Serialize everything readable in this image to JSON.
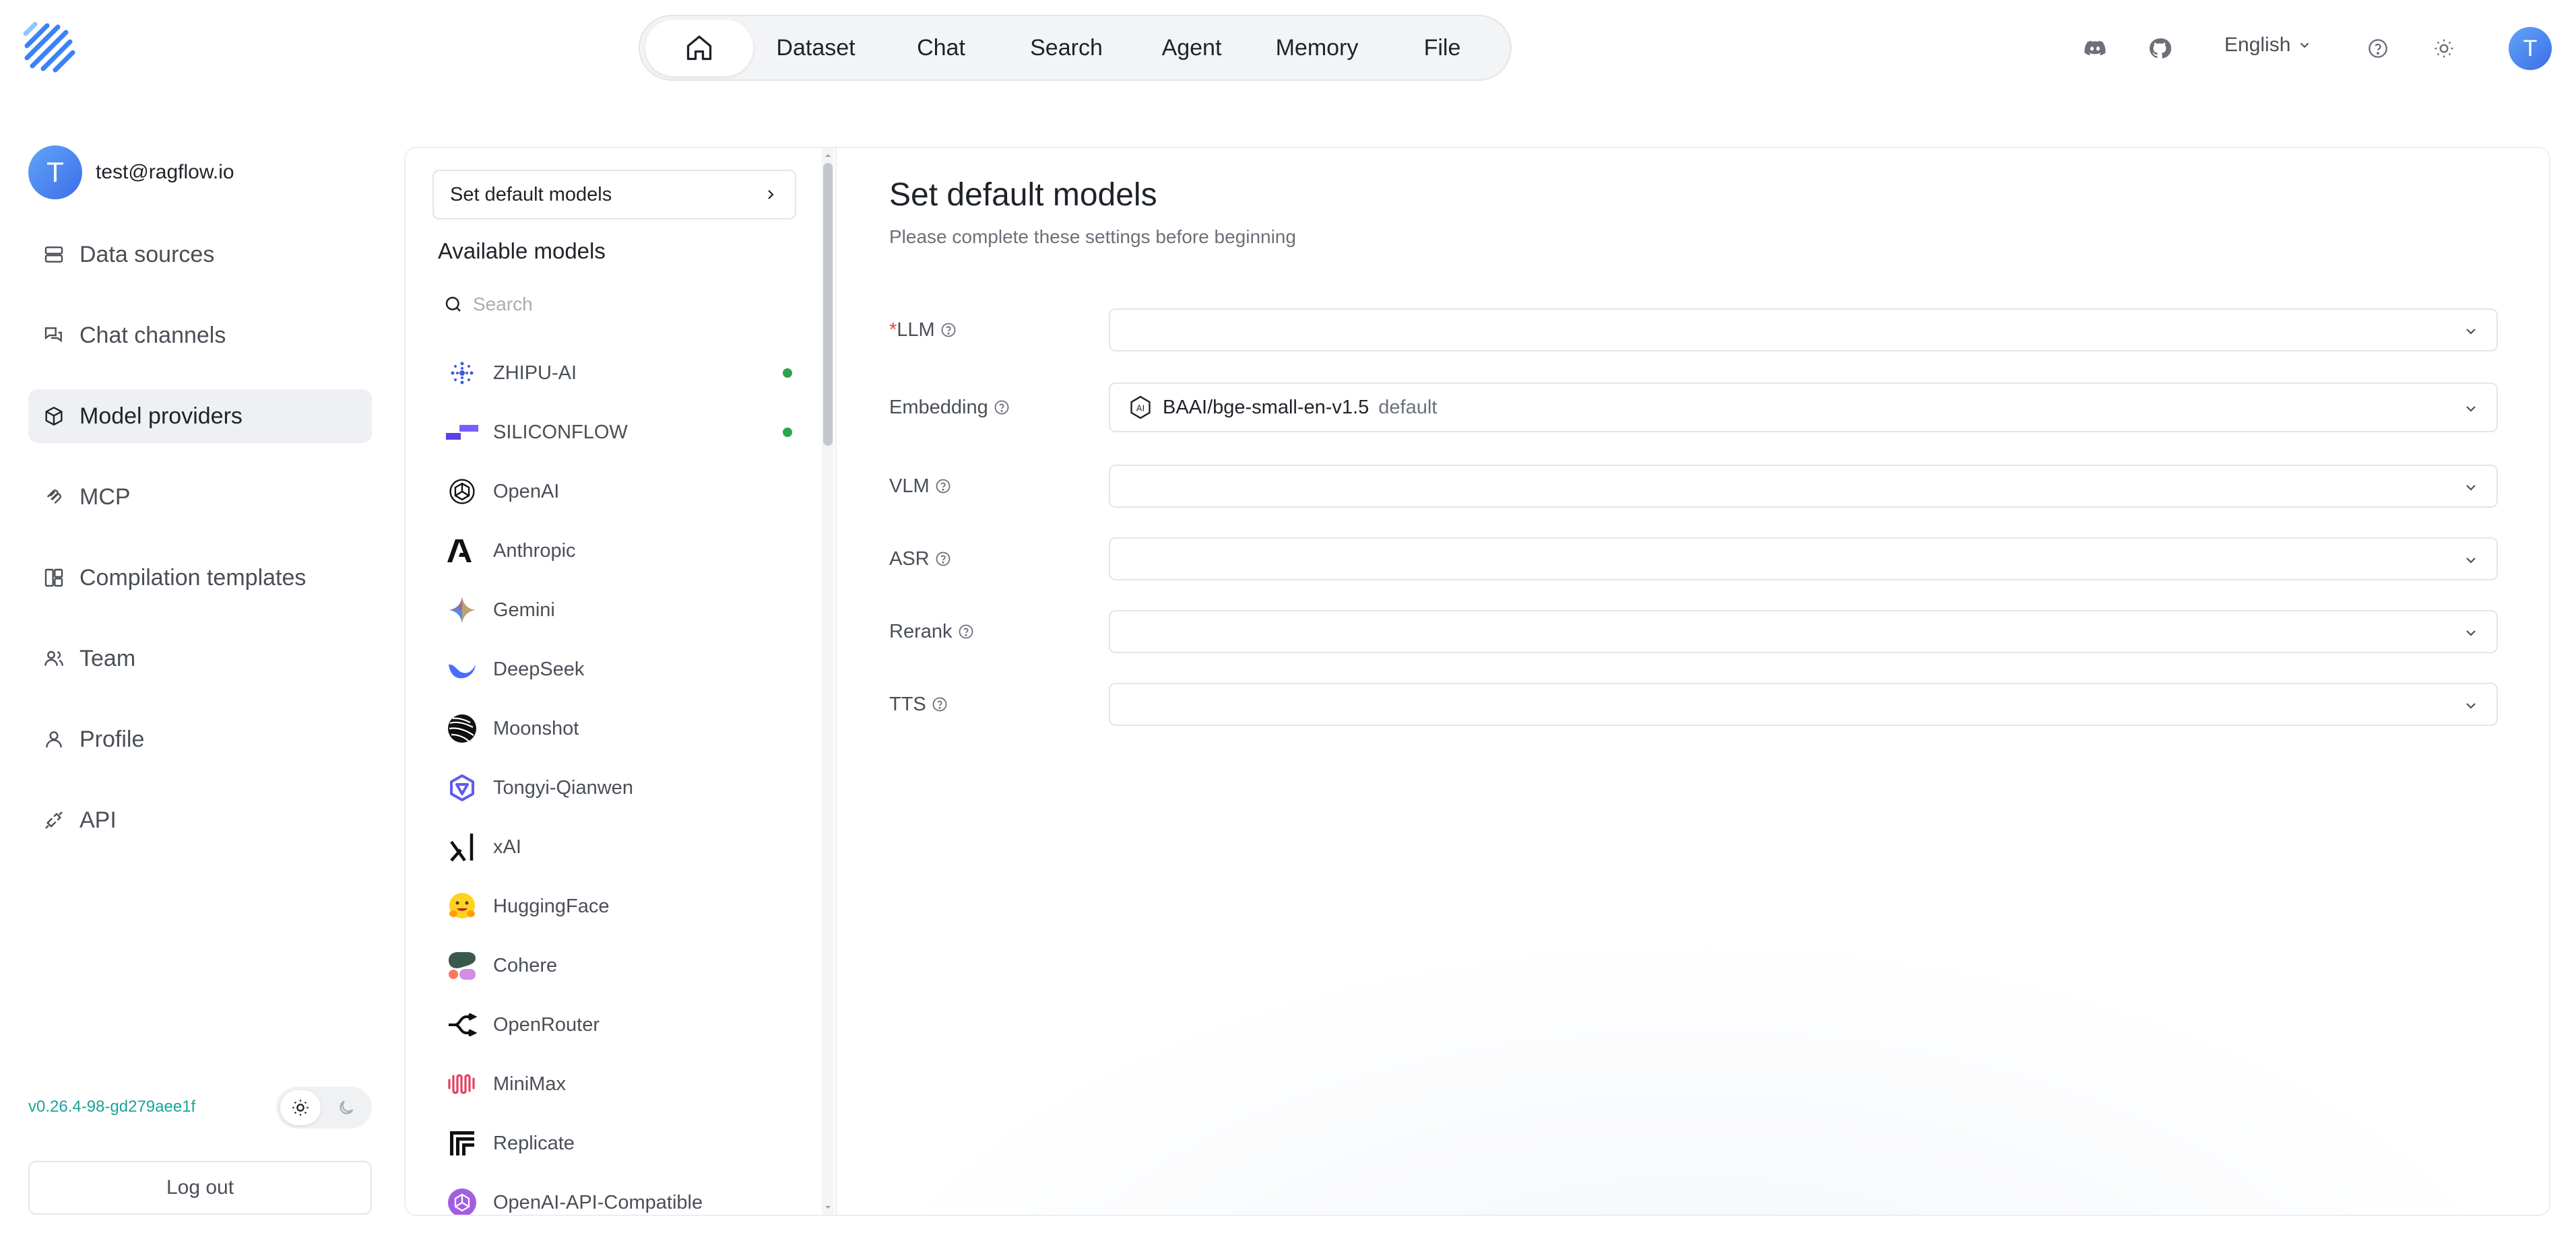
{
  "nav": {
    "items": [
      "Dataset",
      "Chat",
      "Search",
      "Agent",
      "Memory",
      "File"
    ],
    "language": "English",
    "avatar_letter": "T"
  },
  "user": {
    "avatar_letter": "T",
    "email": "test@ragflow.io"
  },
  "sidebar": {
    "items": [
      {
        "label": "Data sources",
        "icon": "data-sources-icon"
      },
      {
        "label": "Chat channels",
        "icon": "chat-channels-icon"
      },
      {
        "label": "Model providers",
        "icon": "cube-icon",
        "active": true
      },
      {
        "label": "MCP",
        "icon": "mcp-icon"
      },
      {
        "label": "Compilation templates",
        "icon": "templates-icon"
      },
      {
        "label": "Team",
        "icon": "team-icon"
      },
      {
        "label": "Profile",
        "icon": "profile-icon"
      },
      {
        "label": "API",
        "icon": "api-icon"
      }
    ],
    "version": "v0.26.4-98-gd279aee1f",
    "logout": "Log out"
  },
  "providers": {
    "set_default": "Set default models",
    "title": "Available models",
    "search_placeholder": "Search",
    "items": [
      {
        "name": "ZHIPU-AI",
        "added": true
      },
      {
        "name": "SILICONFLOW",
        "added": true
      },
      {
        "name": "OpenAI"
      },
      {
        "name": "Anthropic"
      },
      {
        "name": "Gemini"
      },
      {
        "name": "DeepSeek"
      },
      {
        "name": "Moonshot"
      },
      {
        "name": "Tongyi-Qianwen"
      },
      {
        "name": "xAI"
      },
      {
        "name": "HuggingFace"
      },
      {
        "name": "Cohere"
      },
      {
        "name": "OpenRouter"
      },
      {
        "name": "MiniMax"
      },
      {
        "name": "Replicate"
      },
      {
        "name": "OpenAI-API-Compatible"
      }
    ]
  },
  "settings": {
    "title": "Set default models",
    "subtitle": "Please complete these settings before beginning",
    "fields": [
      {
        "label": "LLM",
        "required": true,
        "value": "",
        "tag": ""
      },
      {
        "label": "Embedding",
        "required": false,
        "value": "BAAI/bge-small-en-v1.5",
        "tag": "default"
      },
      {
        "label": "VLM",
        "required": false,
        "value": "",
        "tag": ""
      },
      {
        "label": "ASR",
        "required": false,
        "value": "",
        "tag": ""
      },
      {
        "label": "Rerank",
        "required": false,
        "value": "",
        "tag": ""
      },
      {
        "label": "TTS",
        "required": false,
        "value": "",
        "tag": ""
      }
    ]
  },
  "colors": {
    "accent": "#3b6ee8",
    "version": "#1aa39a",
    "status_ok": "#2da44e",
    "required": "#e34848"
  }
}
